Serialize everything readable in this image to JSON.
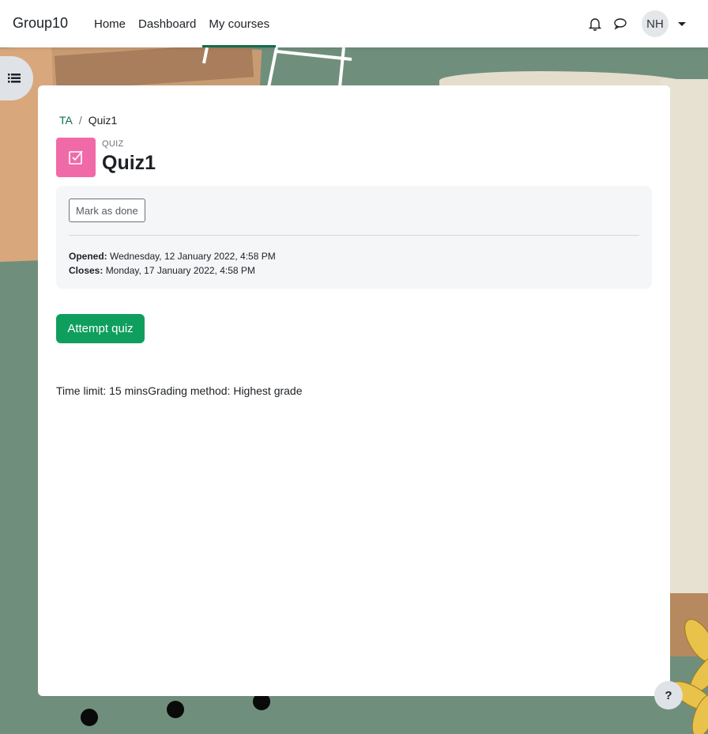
{
  "navbar": {
    "brand": "Group10",
    "links": [
      {
        "label": "Home",
        "active": false
      },
      {
        "label": "Dashboard",
        "active": false
      },
      {
        "label": "My courses",
        "active": true
      }
    ],
    "avatar_initials": "NH",
    "icons": [
      "bell-icon",
      "chat-bubble-icon",
      "chevron-down-icon"
    ]
  },
  "drawer": {
    "icon": "list-icon"
  },
  "breadcrumb": {
    "course": "TA",
    "separator": "/",
    "current": "Quiz1"
  },
  "activity": {
    "modname": "QUIZ",
    "title": "Quiz1",
    "icon": "quiz-check-icon",
    "icon_color": "#f06aa8"
  },
  "completion": {
    "mark_done_label": "Mark as done",
    "opened_label": "Opened:",
    "opened_value": "Wednesday, 12 January 2022, 4:58 PM",
    "closes_label": "Closes:",
    "closes_value": "Monday, 17 January 2022, 4:58 PM"
  },
  "quiz": {
    "attempt_label": "Attempt quiz",
    "limits_text": "Time limit: 15 minsGrading method: Highest grade",
    "primary_color": "#0f9e5e"
  },
  "help": {
    "label": "?"
  }
}
